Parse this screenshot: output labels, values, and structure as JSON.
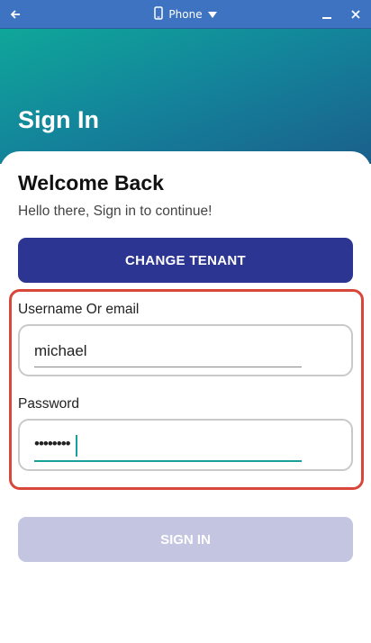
{
  "window": {
    "device_label": "Phone"
  },
  "header": {
    "title": "Sign In"
  },
  "form": {
    "welcome": "Welcome Back",
    "subtitle": "Hello there, Sign in to continue!",
    "change_tenant_label": "CHANGE TENANT",
    "username_label": "Username Or email",
    "username_value": "michael",
    "password_label": "Password",
    "password_value": "••••••••",
    "sign_in_label": "SIGN IN"
  },
  "colors": {
    "header_start": "#0fa79a",
    "header_end": "#1a5f8c",
    "primary_button": "#2c3591",
    "disabled_button": "#c3c5e1",
    "highlight_border": "#d9473a",
    "focus_accent": "#1aa09a"
  },
  "icons": {
    "back": "arrow-left-icon",
    "device": "phone-icon",
    "dropdown": "caret-down-icon",
    "minimize": "minimize-icon",
    "close": "close-icon"
  }
}
